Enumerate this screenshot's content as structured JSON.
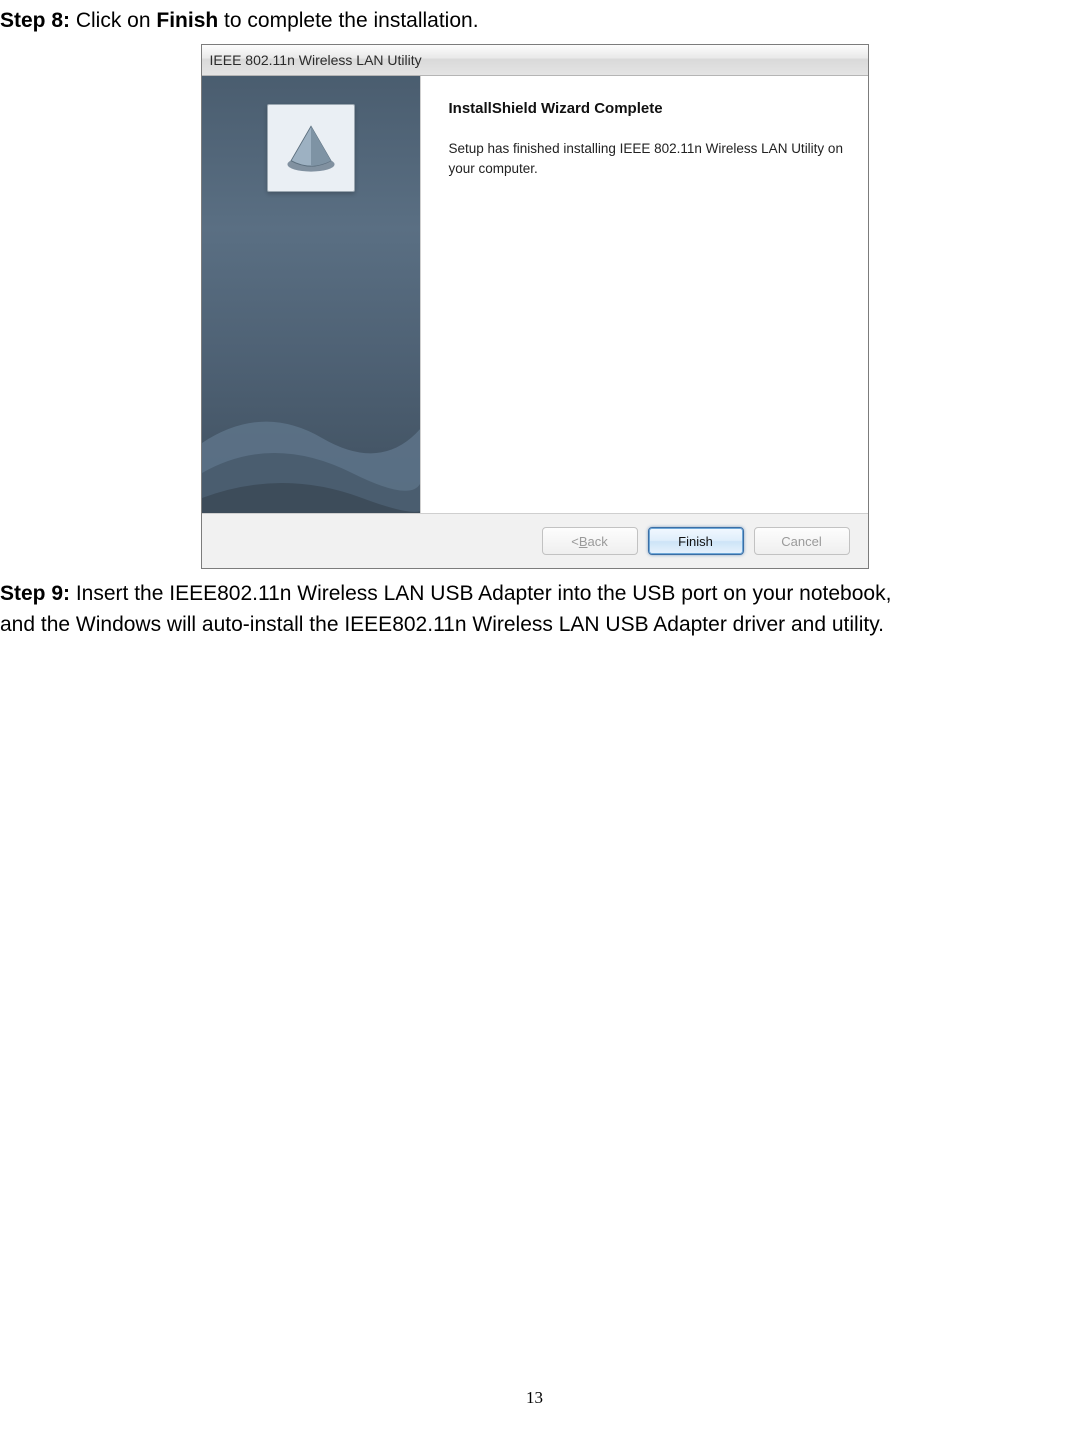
{
  "step8": {
    "label": "Step 8:",
    "pre": " Click on ",
    "bold": "Finish",
    "post": " to complete the installation."
  },
  "installer": {
    "title": "IEEE 802.11n Wireless LAN Utility",
    "heading": "InstallShield Wizard Complete",
    "body": "Setup has finished installing IEEE 802.11n Wireless LAN Utility on your computer.",
    "buttons": {
      "back_prefix": "< ",
      "back_u": "B",
      "back_rest": "ack",
      "finish": "Finish",
      "cancel": "Cancel"
    }
  },
  "step9": {
    "label": "Step 9:",
    "line1_rest": " Insert the IEEE802.11n Wireless LAN USB Adapter into the USB port on your notebook,",
    "line2": "and the Windows will auto-install the IEEE802.11n Wireless LAN USB Adapter driver and utility."
  },
  "page_number": "13"
}
